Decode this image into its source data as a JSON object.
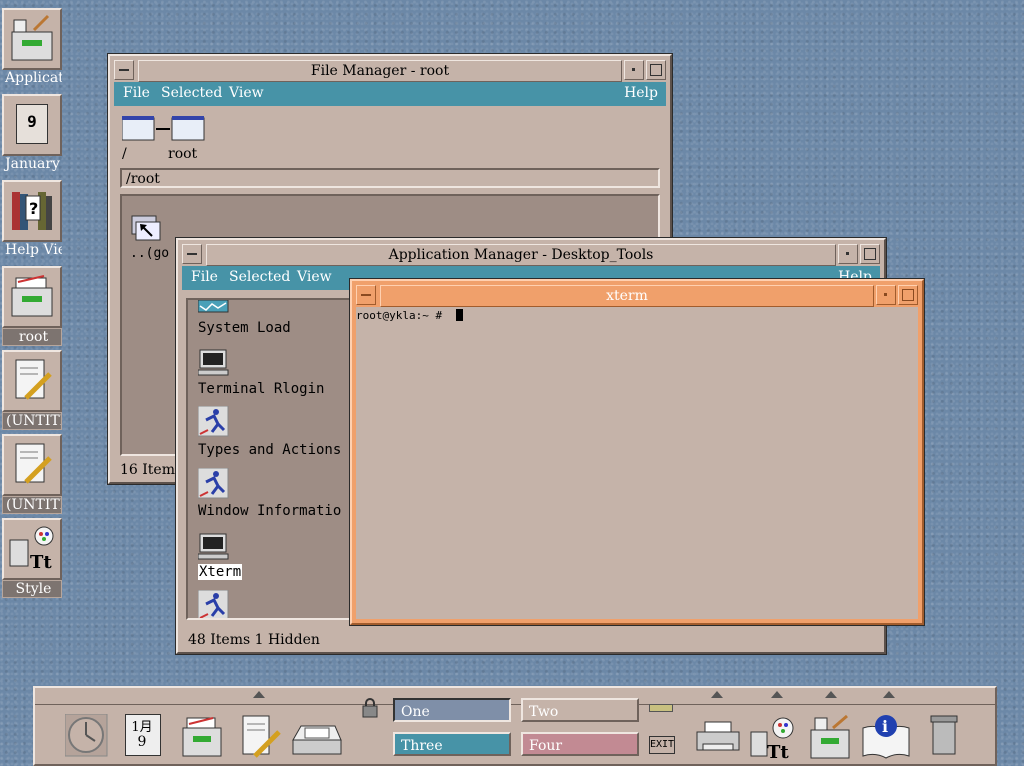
{
  "desktop_icons": [
    {
      "label": "Applicat",
      "icon": "applications-drawer-icon",
      "framed": false
    },
    {
      "label": "January",
      "icon": "calendar-icon",
      "framed": false,
      "day": "9"
    },
    {
      "label": "Help Vie",
      "icon": "help-books-icon",
      "framed": false
    },
    {
      "label": "root",
      "icon": "home-folder-drawer-icon",
      "framed": true
    },
    {
      "label": "(UNTITL",
      "icon": "text-editor-icon",
      "framed": true
    },
    {
      "label": "(UNTITL",
      "icon": "text-editor-icon",
      "framed": true
    },
    {
      "label": "Style",
      "icon": "style-manager-icon",
      "framed": true
    }
  ],
  "file_manager": {
    "title": "File Manager - root",
    "menu": {
      "file": "File",
      "selected": "Selected",
      "view": "View",
      "help": "Help"
    },
    "path_icons": [
      "/",
      "root"
    ],
    "path_field": "/root",
    "item_label": "..(go",
    "status": "16 Items"
  },
  "app_manager": {
    "title": "Application Manager - Desktop_Tools",
    "menu": {
      "file": "File",
      "selected": "Selected",
      "view": "View",
      "help": "Help"
    },
    "items": [
      {
        "label": "System Load",
        "icon": "system-load-icon"
      },
      {
        "label": "Terminal Rlogin",
        "icon": "terminal-icon"
      },
      {
        "label": "Types and Actions",
        "icon": "running-man-icon"
      },
      {
        "label": "Window Informatio",
        "icon": "running-man-icon"
      },
      {
        "label": "Xterm",
        "icon": "terminal-icon",
        "selected": true
      },
      {
        "label": "",
        "icon": "running-man-icon"
      }
    ],
    "status": "48 Items 1 Hidden"
  },
  "xterm": {
    "title": "xterm",
    "prompt": "root@ykla:~ #"
  },
  "front_panel": {
    "calendar": {
      "month": "1月",
      "day": "9"
    },
    "workspaces": [
      {
        "label": "One",
        "color": "#7f8fa8",
        "active": true
      },
      {
        "label": "Two",
        "color": "#c5b3a9",
        "active": false
      },
      {
        "label": "Three",
        "color": "#4793a7",
        "active": false
      },
      {
        "label": "Four",
        "color": "#c28a93",
        "active": false
      }
    ],
    "exit_label": "EXIT",
    "left_icons": [
      "clock-icon",
      "calendar-icon",
      "file-drawer-icon",
      "text-editor-icon",
      "mail-tray-icon"
    ],
    "right_icons": [
      "printer-icon",
      "style-manager-icon",
      "applications-drawer-icon",
      "info-book-icon",
      "trash-icon"
    ]
  },
  "colors": {
    "desktop": "#6c88a7",
    "window": "#c5b3a9",
    "menubar": "#4793a7",
    "xterm_frame": "#f0a06b"
  }
}
